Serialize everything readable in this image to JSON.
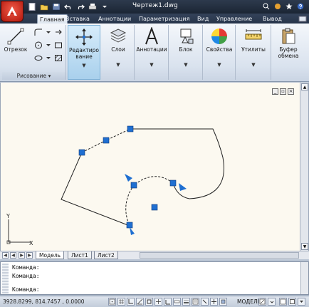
{
  "app": {
    "title": "Чертеж1.dwg",
    "accent": "#c1271b"
  },
  "ribbon_tabs": [
    {
      "label": "Главная",
      "active": true
    },
    {
      "label": "Вставка"
    },
    {
      "label": "Аннотации"
    },
    {
      "label": "Параметризация"
    },
    {
      "label": "Вид"
    },
    {
      "label": "Управление"
    },
    {
      "label": "Вывод"
    }
  ],
  "panels": {
    "draw": {
      "line_label": "Отрезок",
      "title": "Рисование"
    },
    "modify": {
      "label_line1": "Редактиро",
      "label_line2": "вание"
    },
    "layers": {
      "label": "Слои"
    },
    "annotations": {
      "label": "Аннотации"
    },
    "block": {
      "label": "Блок"
    },
    "properties": {
      "label": "Свойства"
    },
    "utilities": {
      "label": "Утилиты"
    },
    "clipboard": {
      "label_line1": "Буфер",
      "label_line2": "обмена"
    }
  },
  "drawing": {
    "background": "#fcf9f0",
    "grip_color": "#1f6fd1",
    "axis_x": "X",
    "axis_y": "Y"
  },
  "layout_tabs": [
    {
      "label": "Модель",
      "active": true
    },
    {
      "label": "Лист1"
    },
    {
      "label": "Лист2"
    }
  ],
  "command_line": {
    "lines": [
      "Команда:",
      "Команда:"
    ],
    "prompt": "Команда:"
  },
  "status_bar": {
    "coordinates": "3928.8299, 814.7457 , 0.0000",
    "space": "МОДЕЛЬ"
  }
}
